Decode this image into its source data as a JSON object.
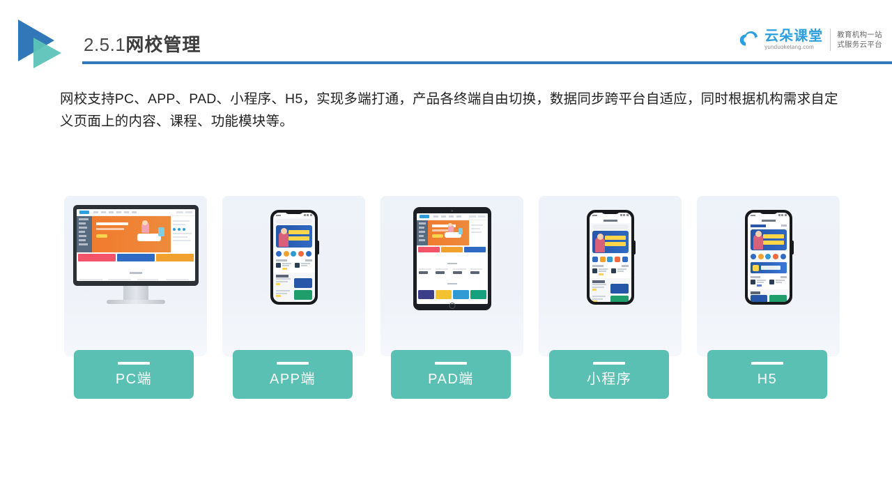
{
  "header": {
    "title_number": "2.5.1",
    "title_text": "网校管理",
    "logo_icon": "double-triangle-play-icon",
    "rule_color": "#3278b8"
  },
  "brand": {
    "cloud_icon": "cloud-icon",
    "name": "云朵课堂",
    "url": "yunduoketang.com",
    "tagline_line1": "教育机构一站",
    "tagline_line2": "式服务云平台",
    "accent_color": "#2b9fe0"
  },
  "body": {
    "paragraph": "网校支持PC、APP、PAD、小程序、H5，实现多端打通，产品各终端自由切换，数据同步跨平台自适应，同时根据机构需求自定义页面上的内容、课程、功能模块等。"
  },
  "cards": [
    {
      "label": "PC端",
      "device": "desktop-monitor-icon",
      "card_name": "card-pc"
    },
    {
      "label": "APP端",
      "device": "smartphone-icon",
      "card_name": "card-app"
    },
    {
      "label": "PAD端",
      "device": "tablet-icon",
      "card_name": "card-pad"
    },
    {
      "label": "小程序",
      "device": "smartphone-icon",
      "card_name": "card-miniprogram"
    },
    {
      "label": "H5",
      "device": "smartphone-icon",
      "card_name": "card-h5"
    }
  ],
  "theme": {
    "label_box_color": "#5bc0b4",
    "card_bg_color": "#eef2f9",
    "title_color": "#3c3c3c",
    "text_color": "#222222"
  }
}
